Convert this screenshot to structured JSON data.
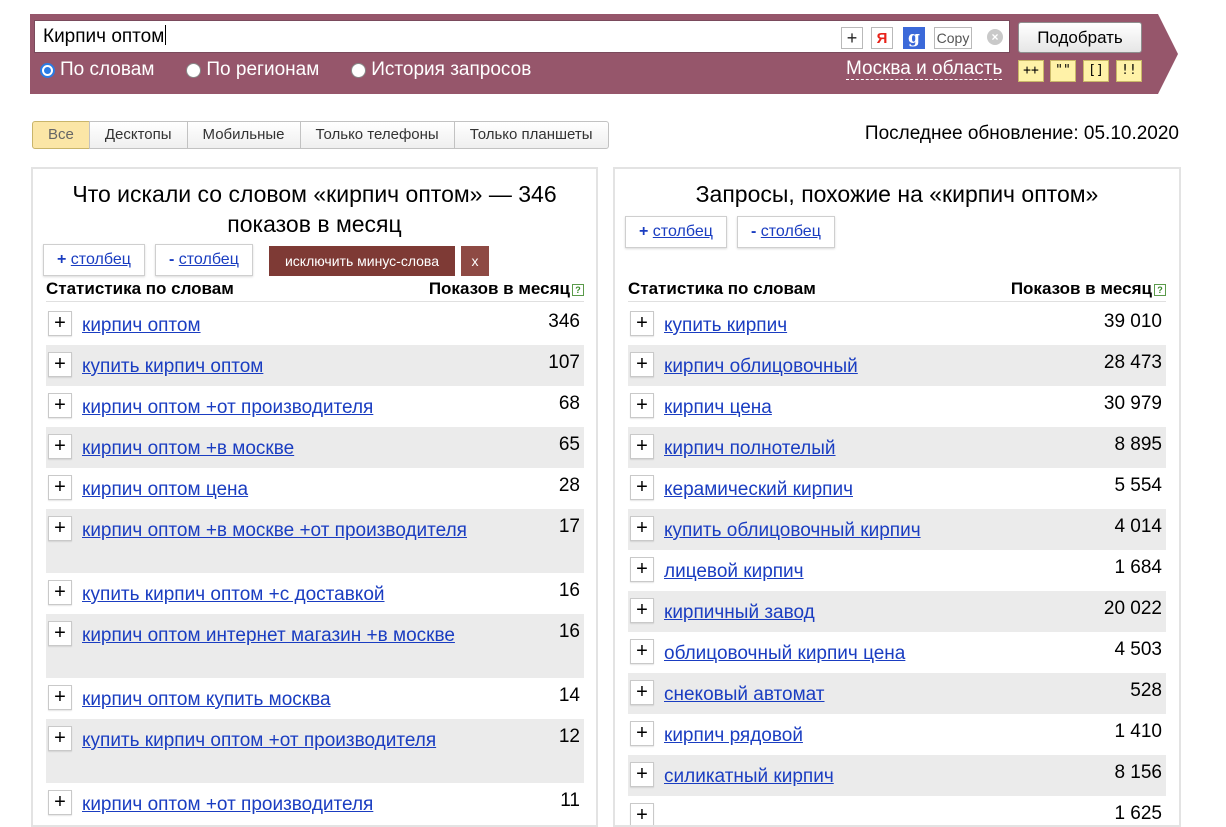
{
  "search": {
    "query": "Кирпич оптом",
    "add_icon": "+",
    "yandex_icon": "Я",
    "google_icon": "g",
    "copy_label": "Copy",
    "clear_icon": "×",
    "submit_label": "Подобрать"
  },
  "modes": [
    {
      "label": "По словам",
      "checked": true
    },
    {
      "label": "По регионам",
      "checked": false
    },
    {
      "label": "История запросов",
      "checked": false
    }
  ],
  "region": "Москва и область",
  "operators": [
    "++",
    "\"\"",
    "[]",
    "!!"
  ],
  "device_tabs": [
    {
      "label": "Все",
      "active": true
    },
    {
      "label": "Десктопы",
      "active": false
    },
    {
      "label": "Мобильные",
      "active": false
    },
    {
      "label": "Только телефоны",
      "active": false
    },
    {
      "label": "Только планшеты",
      "active": false
    }
  ],
  "last_update": "Последнее обновление: 05.10.2020",
  "left_panel": {
    "title": "Что искали со словом «кирпич оптом» — 346 показов в месяц",
    "add_column": "столбец",
    "add_column_sign": "+",
    "remove_column": "столбец",
    "remove_column_sign": "-",
    "exclude_label": "исключить минус-слова",
    "close_label": "x",
    "col_phrase": "Статистика по словам",
    "col_count": "Показов в месяц",
    "help_icon": "?",
    "rows": [
      {
        "phrase": "кирпич оптом",
        "count": "346"
      },
      {
        "phrase": "купить кирпич оптом",
        "count": "107"
      },
      {
        "phrase": "кирпич оптом +от производителя",
        "count": "68"
      },
      {
        "phrase": "кирпич оптом +в москве",
        "count": "65"
      },
      {
        "phrase": "кирпич оптом цена",
        "count": "28"
      },
      {
        "phrase": "кирпич оптом +в москве +от производителя",
        "count": "17"
      },
      {
        "phrase": "купить кирпич оптом +с доставкой",
        "count": "16"
      },
      {
        "phrase": "кирпич оптом интернет магазин +в москве",
        "count": "16"
      },
      {
        "phrase": "кирпич оптом купить москва",
        "count": "14"
      },
      {
        "phrase": "купить кирпич оптом +от производителя",
        "count": "12"
      },
      {
        "phrase": "кирпич оптом +от производителя",
        "count": "11"
      }
    ]
  },
  "right_panel": {
    "title": "Запросы, похожие на «кирпич оптом»",
    "add_column": "столбец",
    "add_column_sign": "+",
    "remove_column": "столбец",
    "remove_column_sign": "-",
    "col_phrase": "Статистика по словам",
    "col_count": "Показов в месяц",
    "help_icon": "?",
    "rows": [
      {
        "phrase": "купить кирпич",
        "count": "39 010"
      },
      {
        "phrase": "кирпич облицовочный",
        "count": "28 473"
      },
      {
        "phrase": "кирпич цена",
        "count": "30 979"
      },
      {
        "phrase": "кирпич полнотелый",
        "count": "8 895"
      },
      {
        "phrase": "керамический кирпич",
        "count": "5 554"
      },
      {
        "phrase": "купить облицовочный кирпич",
        "count": "4 014"
      },
      {
        "phrase": "лицевой кирпич",
        "count": "1 684"
      },
      {
        "phrase": "кирпичный завод",
        "count": "20 022"
      },
      {
        "phrase": "облицовочный кирпич цена",
        "count": "4 503"
      },
      {
        "phrase": "снековый автомат",
        "count": "528"
      },
      {
        "phrase": "кирпич рядовой",
        "count": "1 410"
      },
      {
        "phrase": "силикатный кирпич",
        "count": "8 156"
      },
      {
        "phrase": "",
        "count": "1 625"
      }
    ]
  }
}
